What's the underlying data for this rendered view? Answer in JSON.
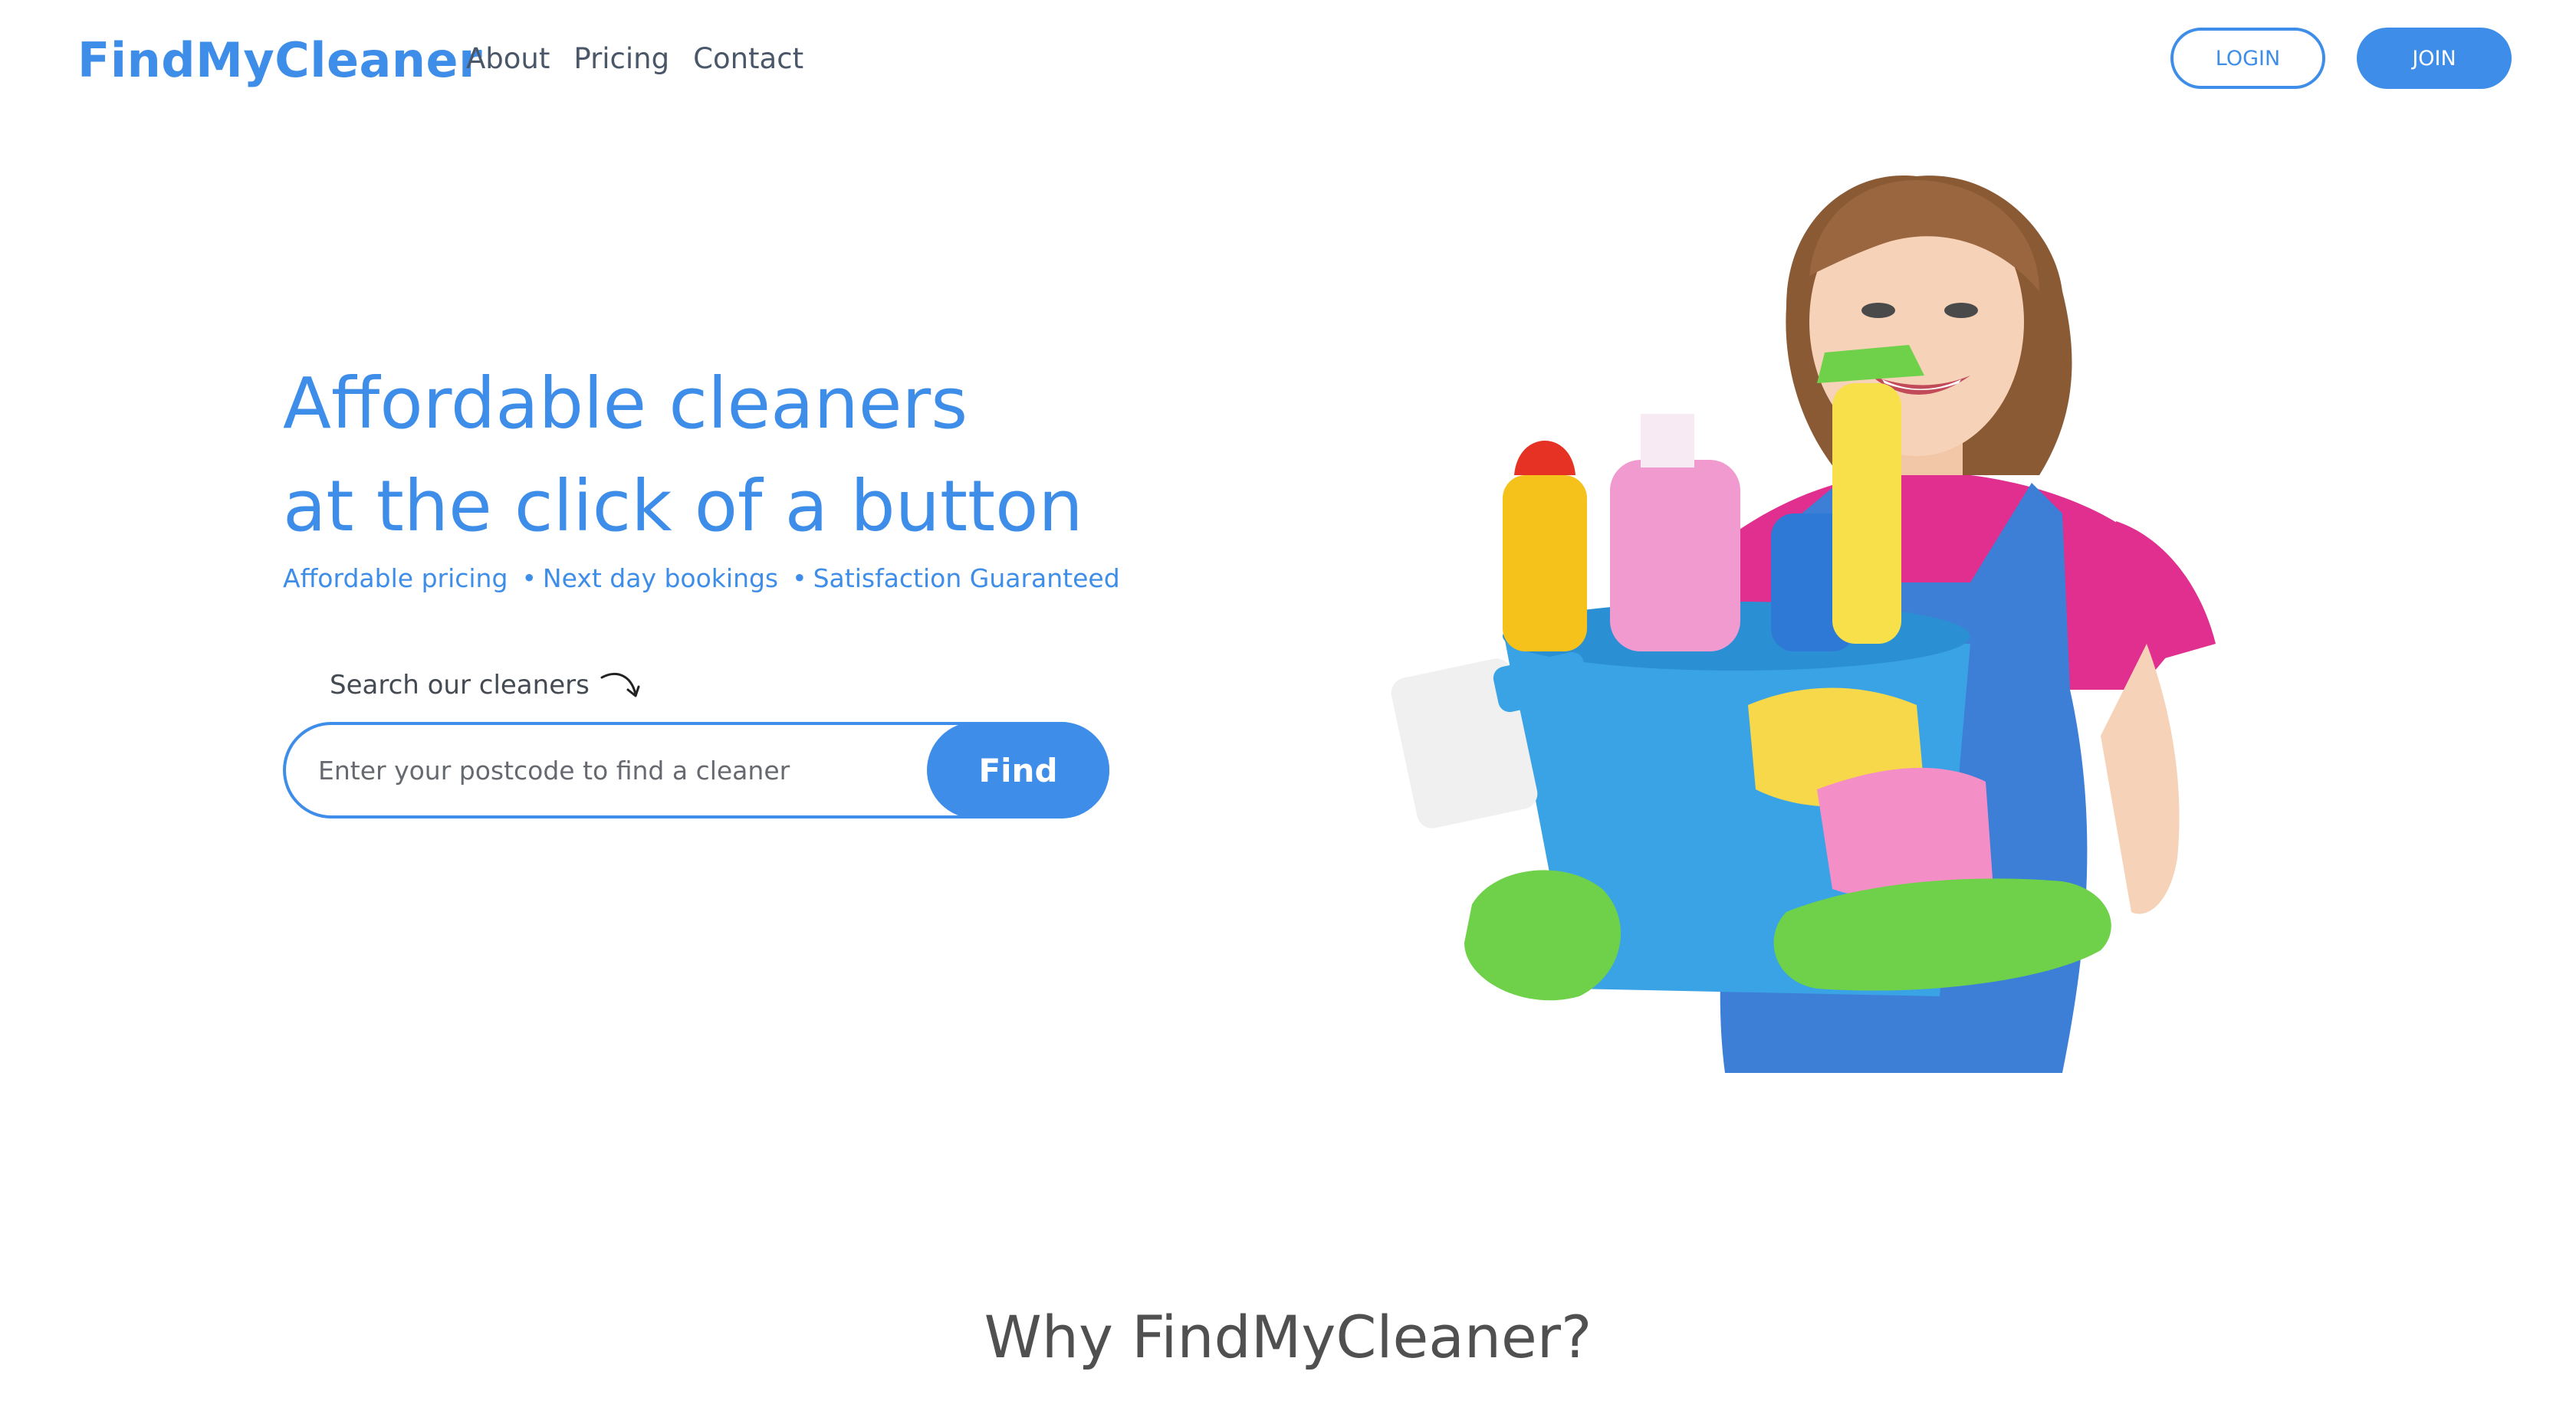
{
  "brand": {
    "name": "FindMyCleaner",
    "accent_color": "#3e8ee9"
  },
  "nav": {
    "links": [
      "About",
      "Pricing",
      "Contact"
    ],
    "login_label": "LOGIN",
    "join_label": "JOIN"
  },
  "hero": {
    "title_line1": "Affordable cleaners",
    "title_line2": "at the click of a button",
    "features": [
      "Affordable pricing",
      "Next day bookings",
      "Satisfaction Guaranteed"
    ],
    "feature_separator": "•",
    "search_hint": "Search our cleaners",
    "search_placeholder": "Enter your postcode to find a cleaner",
    "search_value": "",
    "find_label": "Find"
  },
  "why": {
    "title": "Why FindMyCleaner?"
  }
}
